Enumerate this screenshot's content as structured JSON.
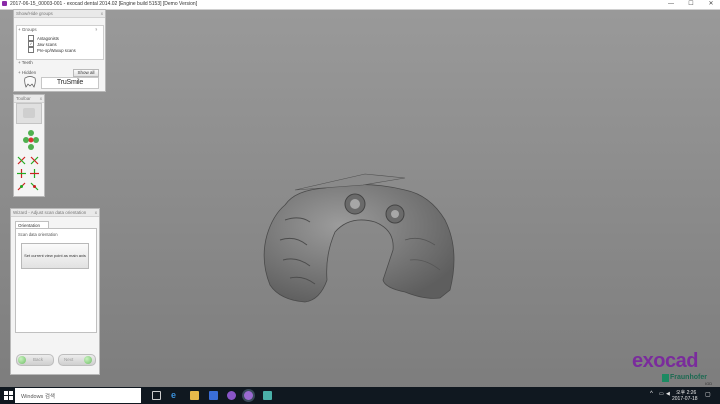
{
  "window": {
    "title": "2017-06-15_00003-001 - exocad dental 2014.02 [Engine build 5153] [Demo Version]",
    "minimize": "—",
    "maximize": "☐",
    "close": "✕"
  },
  "groups_panel": {
    "title": "Show/Hide groups",
    "close": "x",
    "groups_label": "Groups",
    "help": "?",
    "items": [
      {
        "label": "Antagonists",
        "checked": false
      },
      {
        "label": "Jaw scans",
        "checked": true
      },
      {
        "label": "Pre-op/Waxup scans",
        "checked": false
      }
    ],
    "teeth_label": "Teeth",
    "hidden_label": "Hidden",
    "show_all": "Show all",
    "trusmile": "TruSmile"
  },
  "toolbar": {
    "title": "Toolbar",
    "close": "x",
    "icons": [
      "move-icon",
      "rotate-icon",
      "view-front-icon",
      "view-back-icon",
      "view-left-icon",
      "view-right-icon",
      "view-top-icon",
      "view-bottom-icon"
    ]
  },
  "wizard": {
    "title": "Wizard - Adjust scan data orientation",
    "close": "x",
    "tab": "Orientation",
    "group_label": "Scan data orientation",
    "set_view_button": "Set current view point as main axis",
    "back": "Back",
    "next": "Next"
  },
  "logo": {
    "word": "exocad",
    "partner": "Fraunhofer",
    "partner_sub": "IGD"
  },
  "taskbar": {
    "search": "Windows 검색",
    "time": "오후 2:26",
    "date": "2017-07-18",
    "colors": {
      "bg": "#101820",
      "accent": "#3a8fd8"
    }
  }
}
